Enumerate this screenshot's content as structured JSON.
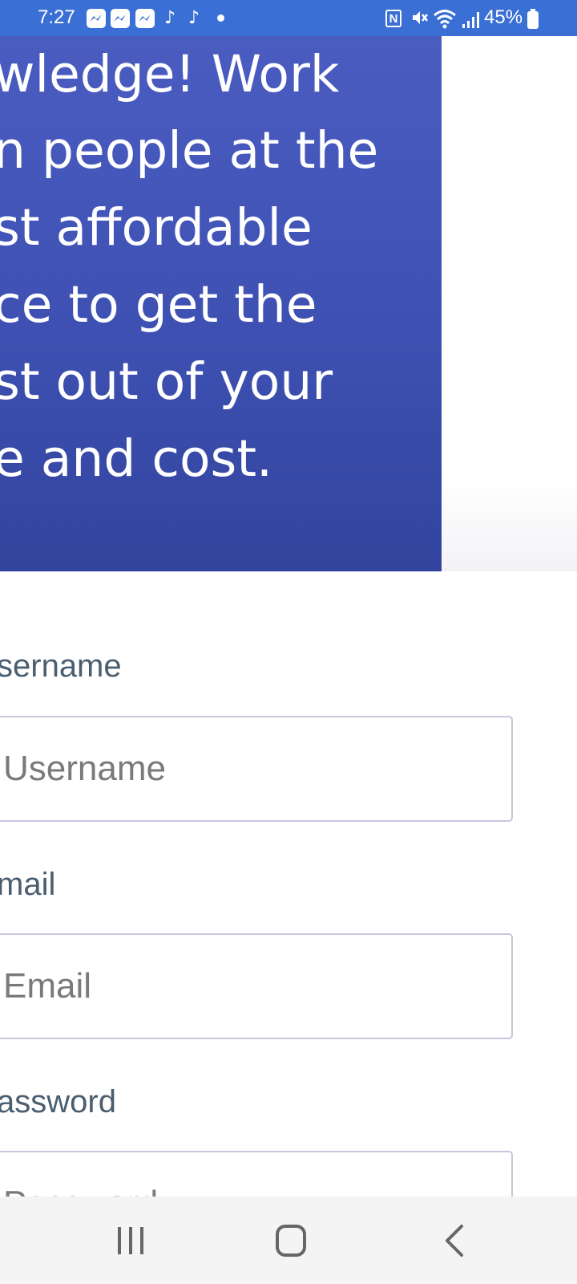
{
  "status_bar": {
    "time": "7:27",
    "battery": "45%",
    "notification_icons": [
      "messenger-icon",
      "messenger-icon",
      "messenger-icon",
      "tiktok-icon",
      "tiktok-icon"
    ]
  },
  "hero": {
    "lines": [
      "wledge! Work",
      "n people at the",
      "st affordable",
      "ce to get the",
      "st out of your",
      "e and cost."
    ],
    "colors": {
      "top": "#4a5cc0",
      "bottom": "#33449e"
    }
  },
  "form": {
    "username": {
      "label": "sername",
      "placeholder": "Username"
    },
    "email": {
      "label": "mail",
      "placeholder": "Email"
    },
    "password": {
      "label": "assword",
      "placeholder": "Password"
    }
  },
  "nav": {
    "icons": [
      "recent-apps-icon",
      "home-icon",
      "back-icon"
    ]
  }
}
